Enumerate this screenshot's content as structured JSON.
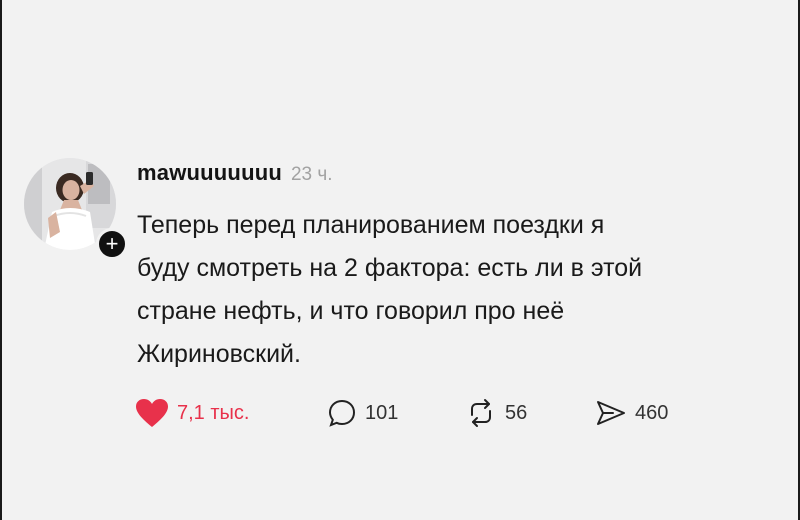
{
  "post": {
    "username": "mawuuuuuuu",
    "time": "23 ч.",
    "lines": [
      "Теперь перед планированием поездки я",
      "буду смотреть на 2 фактора: есть ли в этой",
      "стране нефть, и что говорил про неё",
      "Жириновский."
    ],
    "follow_symbol": "+"
  },
  "actions": {
    "likes": "7,1 тыс.",
    "replies": "101",
    "reposts": "56",
    "shares": "460"
  },
  "icons": {
    "like": "heart-icon",
    "reply": "speech-bubble-icon",
    "repost": "repost-icon",
    "share": "send-icon"
  },
  "colors": {
    "background": "#f2f2f2",
    "like": "#e8314b",
    "text": "#1a1a1a",
    "muted": "#a2a2a2"
  }
}
